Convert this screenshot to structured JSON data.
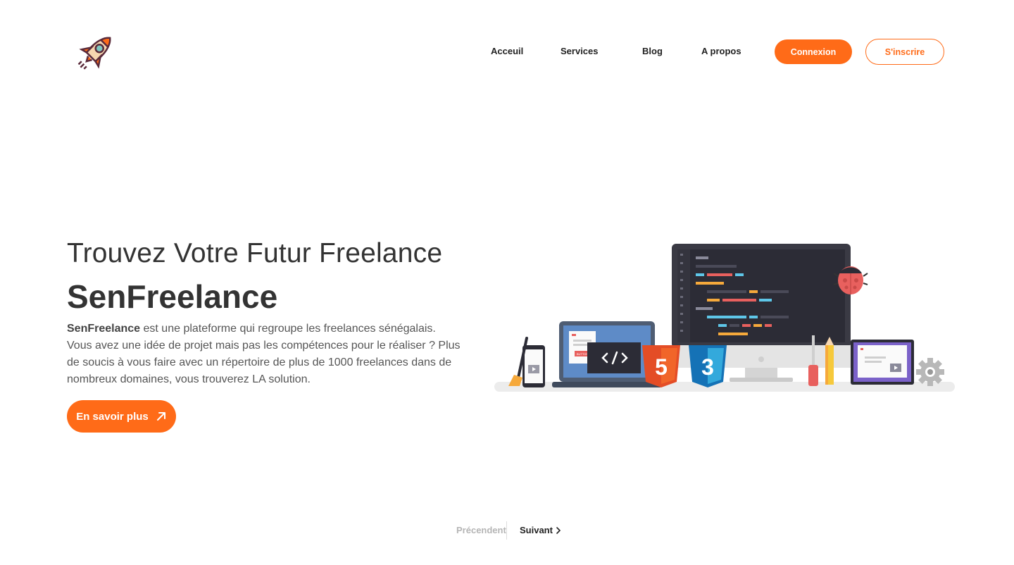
{
  "brand": {
    "logo_icon": "rocket-icon"
  },
  "nav": {
    "links": [
      "Acceuil",
      "Services",
      "Blog",
      "A propos"
    ],
    "login_label": "Connexion",
    "signup_label": "S'inscrire"
  },
  "hero": {
    "subtitle": "Trouvez Votre Futur Freelance",
    "title": "SenFreelance",
    "desc_brand": "SenFreelance",
    "desc_text": " est une plateforme qui regroupe les freelances sénégalais. Vous avez une idée de projet mais pas les compétences pour le réaliser ? Plus de soucis à vous faire avec un répertoire de plus de 1000 freelances dans de nombreux domaines, vous trouverez LA solution.",
    "cta_label": "En savoir plus",
    "cta_icon": "arrow-up-right-icon",
    "illustration_code_button": "BUTTON"
  },
  "pager": {
    "prev_label": "Précendent",
    "next_label": "Suivant",
    "next_icon": "chevron-right-icon"
  },
  "colors": {
    "accent": "#ff6b18",
    "text": "#333333"
  }
}
